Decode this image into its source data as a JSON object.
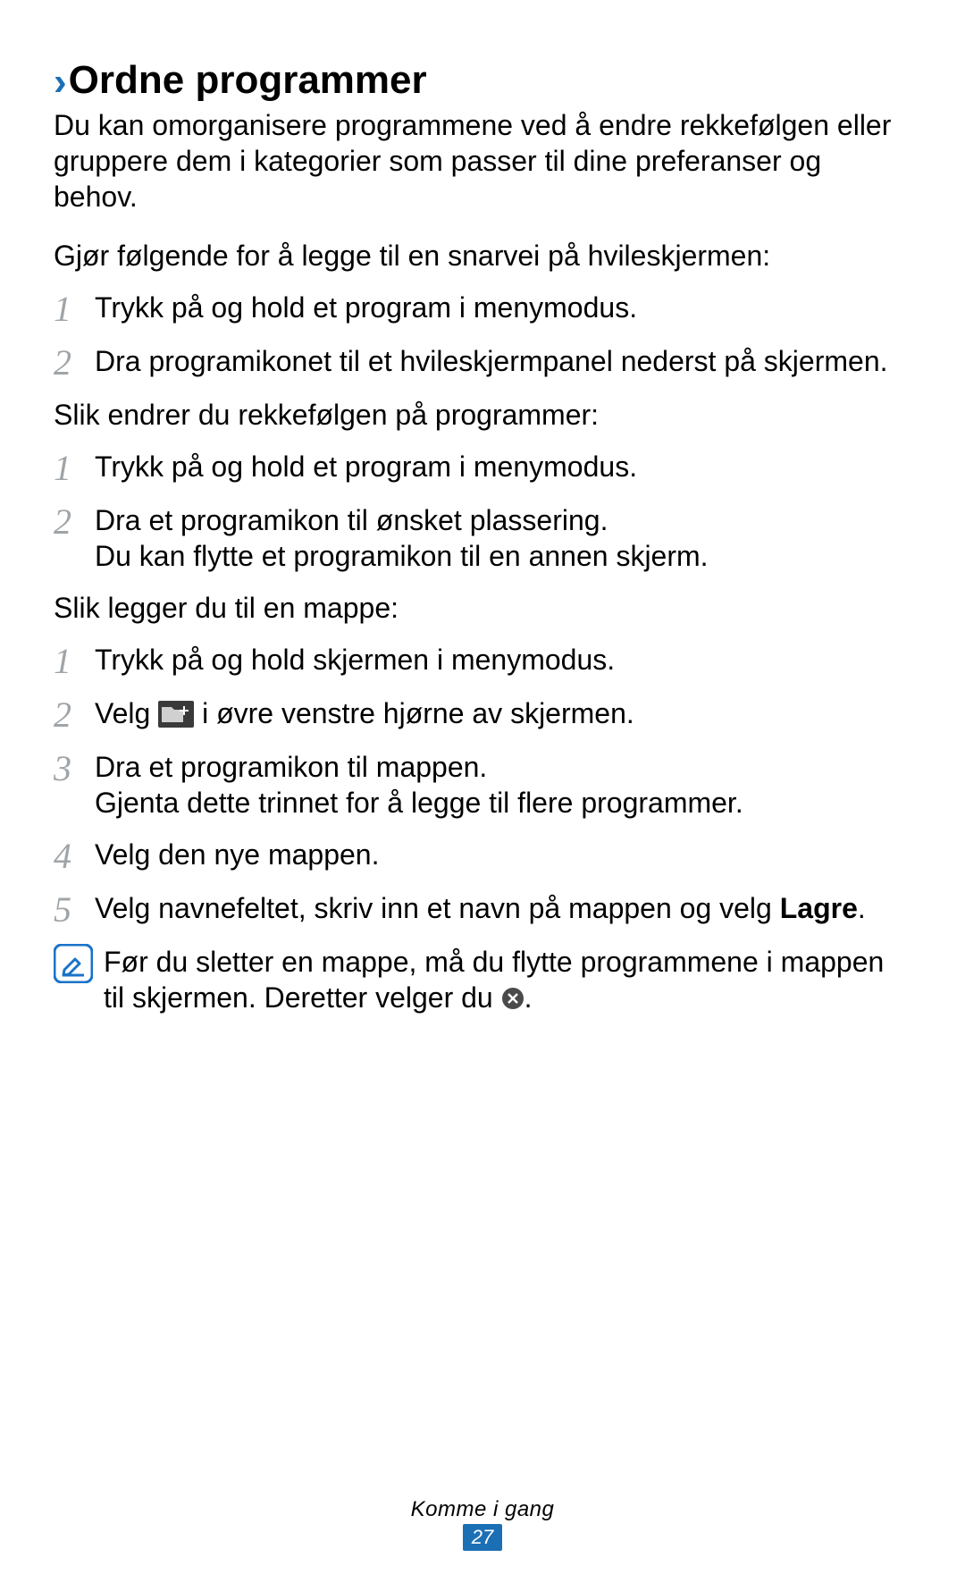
{
  "heading": "Ordne programmer",
  "intro": "Du kan omorganisere programmene ved å endre rekkefølgen eller gruppere dem i kategorier som passer til dine preferanser og behov.",
  "p1": "Gjør følgende for å legge til en snarvei på hvileskjermen:",
  "list1": {
    "s1": "Trykk på og hold et program i menymodus.",
    "s2": "Dra programikonet til et hvileskjermpanel nederst på skjermen."
  },
  "p2": "Slik endrer du rekkefølgen på programmer:",
  "list2": {
    "s1": "Trykk på og hold et program i menymodus.",
    "s2": "Dra et programikon til ønsket plassering.\nDu kan flytte et programikon til en annen skjerm."
  },
  "p3": "Slik legger du til en mappe:",
  "list3": {
    "s1": "Trykk på og hold skjermen i menymodus.",
    "s2_a": "Velg ",
    "s2_b": " i øvre venstre hjørne av skjermen.",
    "s3": "Dra et programikon til mappen.\nGjenta dette trinnet for å legge til flere programmer.",
    "s4": "Velg den nye mappen.",
    "s5_a": "Velg navnefeltet, skriv inn et navn på mappen og velg ",
    "s5_b": "Lagre",
    "s5_c": "."
  },
  "note_a": "Før du sletter en mappe, må du flytte programmene i mappen til skjermen. Deretter velger du ",
  "note_b": ".",
  "footer_title": "Komme i gang",
  "page_number": "27",
  "nums": {
    "n1": "1",
    "n2": "2",
    "n3": "3",
    "n4": "4",
    "n5": "5"
  }
}
